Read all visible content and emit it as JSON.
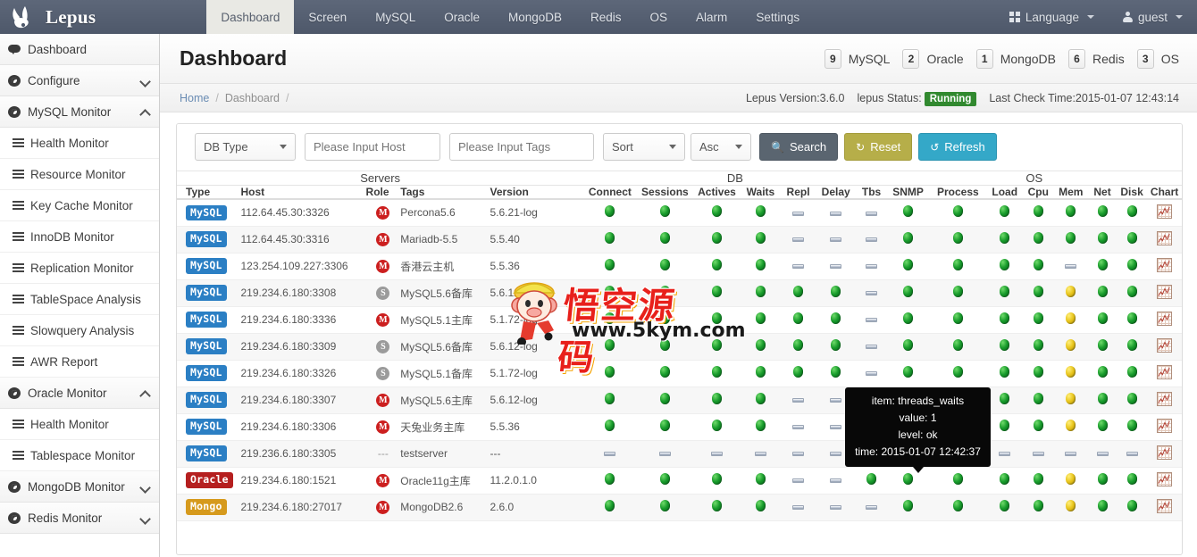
{
  "brand": {
    "name": "Lepus",
    "logo_icon": "rabbit-logo-icon"
  },
  "navbar": {
    "items": [
      {
        "label": "Dashboard",
        "active": true
      },
      {
        "label": "Screen",
        "active": false
      },
      {
        "label": "MySQL",
        "active": false
      },
      {
        "label": "Oracle",
        "active": false
      },
      {
        "label": "MongoDB",
        "active": false
      },
      {
        "label": "Redis",
        "active": false
      },
      {
        "label": "OS",
        "active": false
      },
      {
        "label": "Alarm",
        "active": false
      },
      {
        "label": "Settings",
        "active": false
      }
    ],
    "language": "Language",
    "user": "guest"
  },
  "sidebar": {
    "items": [
      {
        "label": "Dashboard",
        "icon": "speech-bubble-icon",
        "level": "top",
        "chevron": ""
      },
      {
        "label": "Configure",
        "icon": "gauge-icon",
        "level": "top",
        "chevron": "down"
      },
      {
        "label": "MySQL Monitor",
        "icon": "gauge-icon",
        "level": "top",
        "chevron": "up"
      },
      {
        "label": "Health Monitor",
        "icon": "list-icon",
        "level": "sub",
        "chevron": ""
      },
      {
        "label": "Resource Monitor",
        "icon": "list-icon",
        "level": "sub",
        "chevron": ""
      },
      {
        "label": "Key Cache Monitor",
        "icon": "list-icon",
        "level": "sub",
        "chevron": ""
      },
      {
        "label": "InnoDB Monitor",
        "icon": "list-icon",
        "level": "sub",
        "chevron": ""
      },
      {
        "label": "Replication Monitor",
        "icon": "list-icon",
        "level": "sub",
        "chevron": ""
      },
      {
        "label": "TableSpace Analysis",
        "icon": "list-icon",
        "level": "sub",
        "chevron": ""
      },
      {
        "label": "Slowquery Analysis",
        "icon": "list-icon",
        "level": "sub",
        "chevron": ""
      },
      {
        "label": "AWR Report",
        "icon": "list-icon",
        "level": "sub",
        "chevron": ""
      },
      {
        "label": "Oracle Monitor",
        "icon": "gauge-icon",
        "level": "top",
        "chevron": "up"
      },
      {
        "label": "Health Monitor",
        "icon": "list-icon",
        "level": "sub",
        "chevron": ""
      },
      {
        "label": "Tablespace Monitor",
        "icon": "list-icon",
        "level": "sub",
        "chevron": ""
      },
      {
        "label": "MongoDB Monitor",
        "icon": "gauge-icon",
        "level": "top",
        "chevron": "down"
      },
      {
        "label": "Redis Monitor",
        "icon": "gauge-icon",
        "level": "top",
        "chevron": "down"
      }
    ]
  },
  "page": {
    "title": "Dashboard",
    "badges": [
      {
        "count": "9",
        "label": "MySQL"
      },
      {
        "count": "2",
        "label": "Oracle"
      },
      {
        "count": "1",
        "label": "MongoDB"
      },
      {
        "count": "6",
        "label": "Redis"
      },
      {
        "count": "3",
        "label": "OS"
      }
    ],
    "breadcrumb": {
      "home": "Home",
      "sep1": "/",
      "current": "Dashboard",
      "sep2": "/"
    },
    "meta": {
      "version": "Lepus Version:3.6.0",
      "status_label": "lepus Status:",
      "status_value": "Running",
      "last_check": "Last Check Time:2015-01-07 12:43:14"
    }
  },
  "filters": {
    "db_type": "DB Type",
    "host_placeholder": "Please Input Host",
    "tags_placeholder": "Please Input Tags",
    "sort": "Sort",
    "order": "Asc",
    "search_button": "Search",
    "reset_button": "Reset",
    "refresh_button": "Refresh"
  },
  "table": {
    "groups": [
      {
        "label": "Servers",
        "span": 5
      },
      {
        "label": "DB",
        "span": 7
      },
      {
        "label": "OS",
        "span": 7
      }
    ],
    "columns": [
      "Type",
      "Host",
      "Role",
      "Tags",
      "Version",
      "Connect",
      "Sessions",
      "Actives",
      "Waits",
      "Repl",
      "Delay",
      "Tbs",
      "SNMP",
      "Process",
      "Load",
      "Cpu",
      "Mem",
      "Net",
      "Disk",
      "Chart"
    ],
    "rows": [
      {
        "type": "MySQL",
        "type_kind": "mysql",
        "host": "112.64.45.30:3326",
        "role": "M",
        "tags": "Percona5.6",
        "version": "5.6.21-log",
        "status": [
          "ok",
          "ok",
          "ok",
          "ok",
          "na",
          "na",
          "na",
          "ok",
          "ok",
          "ok",
          "ok",
          "ok",
          "ok",
          "ok"
        ]
      },
      {
        "type": "MySQL",
        "type_kind": "mysql",
        "host": "112.64.45.30:3316",
        "role": "M",
        "tags": "Mariadb-5.5",
        "version": "5.5.40",
        "status": [
          "ok",
          "ok",
          "ok",
          "ok",
          "na",
          "na",
          "na",
          "ok",
          "ok",
          "ok",
          "ok",
          "ok",
          "ok",
          "ok"
        ]
      },
      {
        "type": "MySQL",
        "type_kind": "mysql",
        "host": "123.254.109.227:3306",
        "role": "M",
        "tags": "香港云主机",
        "version": "5.5.36",
        "status": [
          "ok",
          "ok",
          "ok",
          "ok",
          "na",
          "na",
          "na",
          "ok",
          "ok",
          "ok",
          "ok",
          "na",
          "ok",
          "ok"
        ]
      },
      {
        "type": "MySQL",
        "type_kind": "mysql",
        "host": "219.234.6.180:3308",
        "role": "S",
        "tags": "MySQL5.6备库",
        "version": "5.6.12-log",
        "status": [
          "ok",
          "ok",
          "ok",
          "ok",
          "ok",
          "ok",
          "na",
          "ok",
          "ok",
          "ok",
          "ok",
          "warn",
          "ok",
          "ok"
        ]
      },
      {
        "type": "MySQL",
        "type_kind": "mysql",
        "host": "219.234.6.180:3336",
        "role": "M",
        "tags": "MySQL5.1主库",
        "version": "5.1.72-log",
        "status": [
          "ok",
          "ok",
          "ok",
          "ok",
          "ok",
          "ok",
          "na",
          "ok",
          "ok",
          "ok",
          "ok",
          "warn",
          "ok",
          "ok"
        ]
      },
      {
        "type": "MySQL",
        "type_kind": "mysql",
        "host": "219.234.6.180:3309",
        "role": "S",
        "tags": "MySQL5.6备库",
        "version": "5.6.12-log",
        "status": [
          "ok",
          "ok",
          "ok",
          "ok",
          "ok",
          "ok",
          "na",
          "ok",
          "ok",
          "ok",
          "ok",
          "warn",
          "ok",
          "ok"
        ]
      },
      {
        "type": "MySQL",
        "type_kind": "mysql",
        "host": "219.234.6.180:3326",
        "role": "S",
        "tags": "MySQL5.1备库",
        "version": "5.1.72-log",
        "status": [
          "ok",
          "ok",
          "ok",
          "ok",
          "ok",
          "ok",
          "na",
          "ok",
          "ok",
          "ok",
          "ok",
          "warn",
          "ok",
          "ok"
        ]
      },
      {
        "type": "MySQL",
        "type_kind": "mysql",
        "host": "219.234.6.180:3307",
        "role": "M",
        "tags": "MySQL5.6主库",
        "version": "5.6.12-log",
        "status": [
          "ok",
          "ok",
          "ok",
          "ok",
          "na",
          "na",
          "na",
          "ok",
          "ok",
          "ok",
          "ok",
          "warn",
          "ok",
          "ok"
        ]
      },
      {
        "type": "MySQL",
        "type_kind": "mysql",
        "host": "219.234.6.180:3306",
        "role": "M",
        "tags": "天兔业务主库",
        "version": "5.5.36",
        "status": [
          "ok",
          "ok",
          "ok",
          "ok",
          "na",
          "na",
          "na",
          "ok",
          "ok",
          "ok",
          "ok",
          "warn",
          "ok",
          "ok"
        ]
      },
      {
        "type": "MySQL",
        "type_kind": "mysql",
        "host": "219.236.6.180:3305",
        "role": "---",
        "tags": "testserver",
        "version": "---",
        "status": [
          "na",
          "na",
          "na",
          "na",
          "na",
          "na",
          "na",
          "na",
          "na",
          "na",
          "na",
          "na",
          "na",
          "na"
        ]
      },
      {
        "type": "Oracle",
        "type_kind": "oracle",
        "host": "219.234.6.180:1521",
        "role": "M",
        "tags": "Oracle11g主库",
        "version": "11.2.0.1.0",
        "status": [
          "ok",
          "ok",
          "ok",
          "ok",
          "na",
          "na",
          "ok",
          "ok",
          "ok",
          "ok",
          "ok",
          "warn",
          "ok",
          "ok"
        ]
      },
      {
        "type": "Mongo",
        "type_kind": "mongo",
        "host": "219.234.6.180:27017",
        "role": "M",
        "tags": "MongoDB2.6",
        "version": "2.6.0",
        "status": [
          "ok",
          "ok",
          "ok",
          "ok",
          "na",
          "na",
          "na",
          "ok",
          "ok",
          "ok",
          "ok",
          "warn",
          "ok",
          "ok"
        ]
      }
    ]
  },
  "tooltip": {
    "item": "item: threads_waits",
    "value": "value: 1",
    "level": "level: ok",
    "time": "time: 2015-01-07 12:42:37"
  },
  "watermark": {
    "cn": "悟空源码",
    "url": "www.5kym.com"
  },
  "colors": {
    "navbar": "#555f71",
    "accent_blue": "#2b7fc4",
    "status_running": "#31892f",
    "search_button": "#5a6570",
    "reset_button": "#b6ae49",
    "refresh_button": "#34a8c8",
    "ok": "#16992a",
    "warn": "#e8c41b"
  }
}
